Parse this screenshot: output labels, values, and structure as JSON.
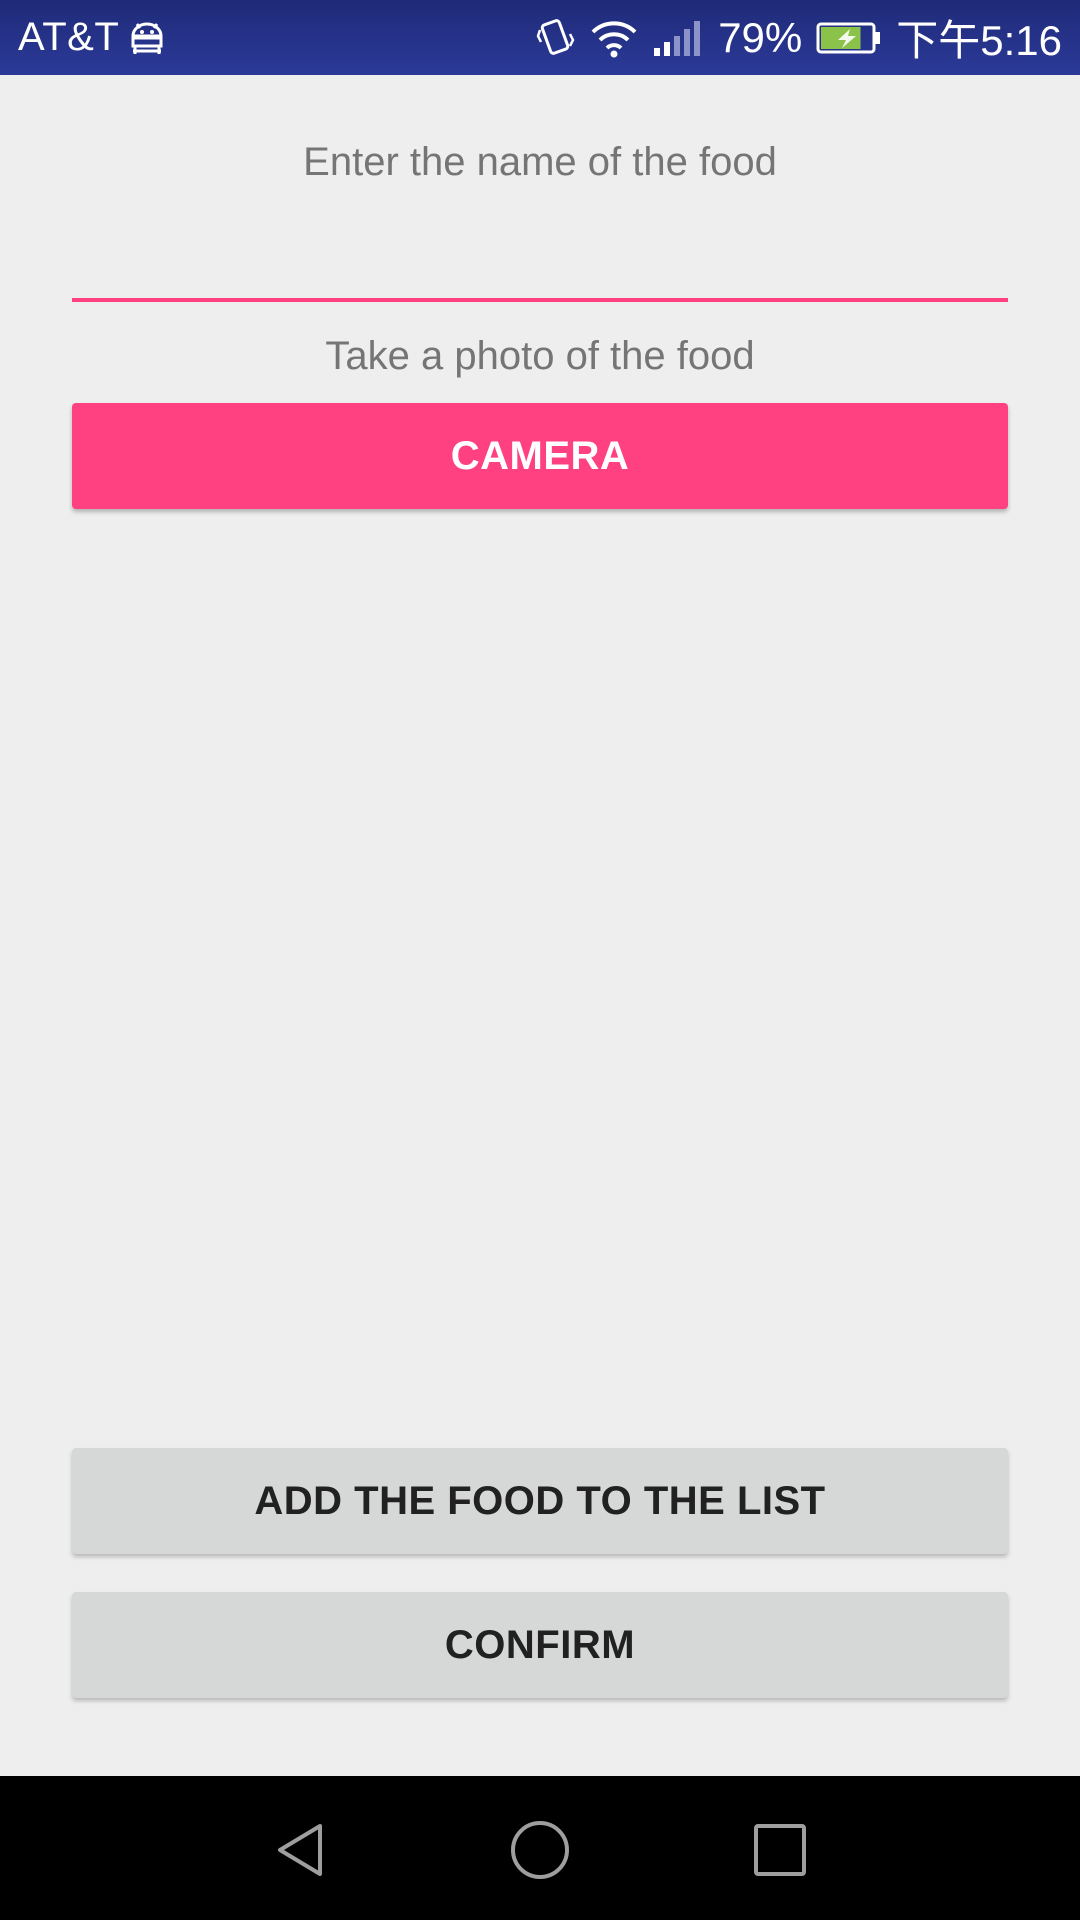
{
  "status_bar": {
    "carrier": "AT&T",
    "battery_percent": "79%",
    "time": "下午5:16",
    "icons": [
      "android-debug-icon",
      "vibrate-icon",
      "wifi-icon",
      "signal-icon",
      "battery-charging-icon"
    ],
    "battery_level": 0.79,
    "battery_color": "#8bc34a"
  },
  "form": {
    "name_prompt": "Enter the name of the food",
    "name_value": "",
    "name_placeholder": "",
    "photo_prompt": "Take a photo of the food",
    "camera_label": "CAMERA",
    "add_label": "ADD THE FOOD TO THE LIST",
    "confirm_label": "CONFIRM"
  },
  "colors": {
    "accent": "#ff4081",
    "status_bar": "#2b3a98",
    "background": "#eeeeee",
    "grey_button": "#d6d7d7"
  },
  "nav_bar": {
    "icons": [
      "back-icon",
      "home-icon",
      "recent-apps-icon"
    ]
  }
}
